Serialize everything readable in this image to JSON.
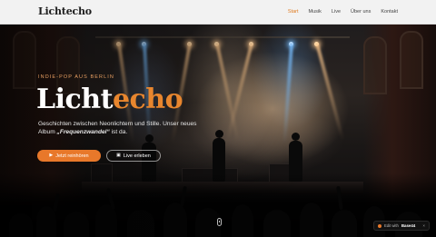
{
  "header": {
    "logo": "Lichtecho",
    "nav": [
      {
        "label": "Start",
        "active": true
      },
      {
        "label": "Musik",
        "active": false
      },
      {
        "label": "Live",
        "active": false
      },
      {
        "label": "Über uns",
        "active": false
      },
      {
        "label": "Kontakt",
        "active": false
      }
    ]
  },
  "hero": {
    "eyebrow": "INDIE-POP AUS BERLIN",
    "title_main": "Licht",
    "title_accent": "echo",
    "lead_before": "Geschichten zwischen Neonlichtern und Stille. Unser neues Album ",
    "lead_album": "„Frequenzwandel“",
    "lead_after": " ist da.",
    "primary_button": {
      "label": "Jetzt reinhören",
      "icon": "play-icon"
    },
    "secondary_button": {
      "label": "Live erleben",
      "icon": "calendar-icon"
    }
  },
  "badge": {
    "prefix": "Edit with",
    "brand": "Base44",
    "close": "×"
  },
  "colors": {
    "accent": "#e8782a",
    "header_bg": "#f2f2f2",
    "eyebrow": "#e9a063"
  }
}
